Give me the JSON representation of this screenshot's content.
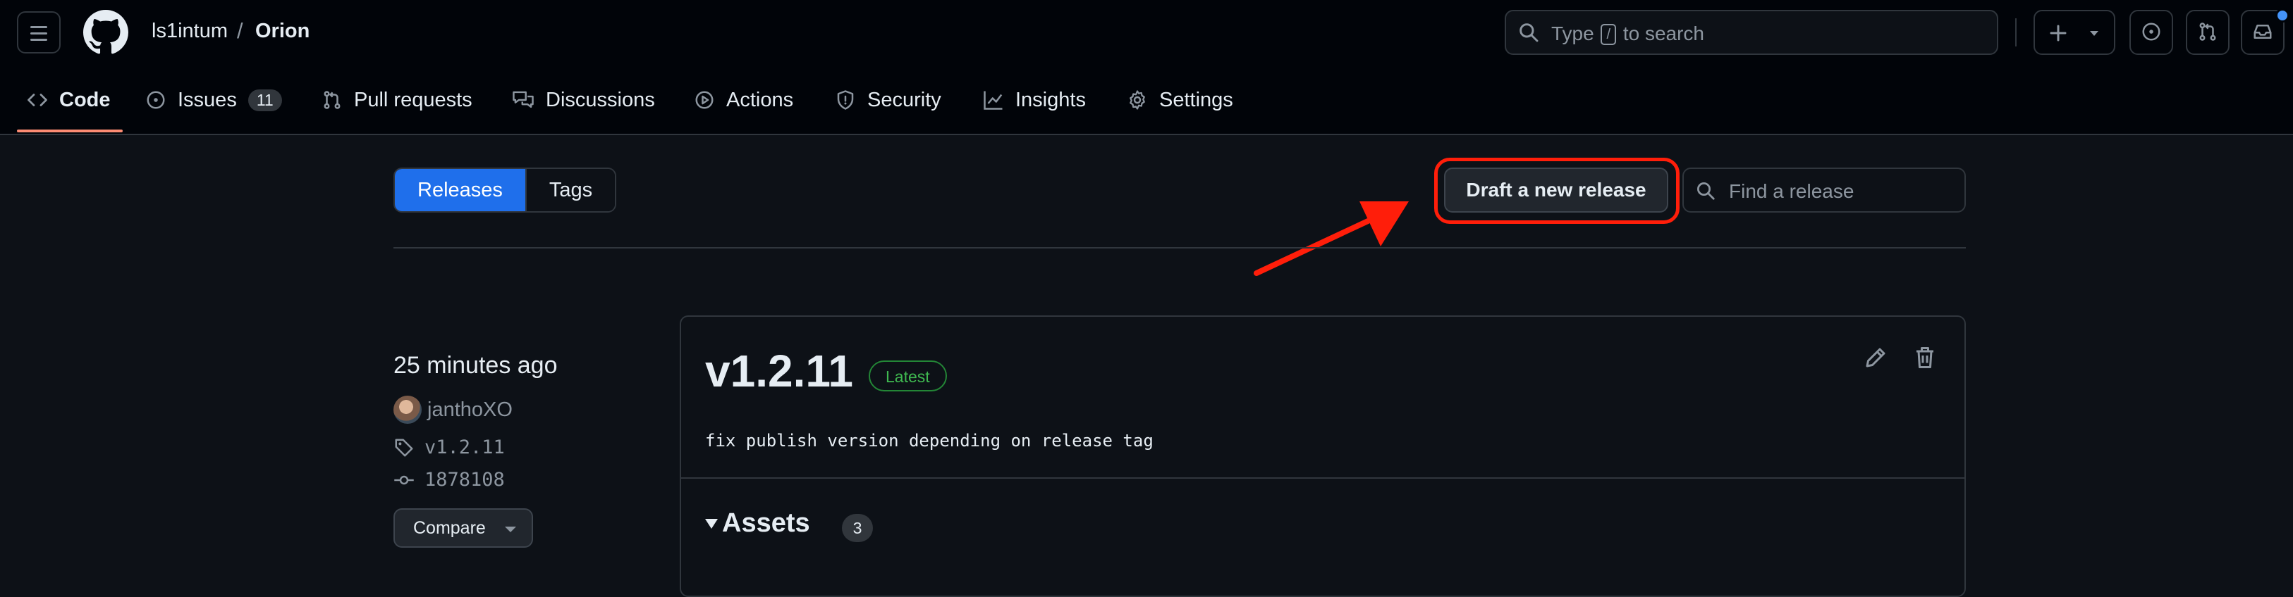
{
  "header": {
    "owner": "ls1intum",
    "separator": "/",
    "repo": "Orion",
    "search": {
      "prefix": "Type",
      "key": "/",
      "suffix": "to search"
    }
  },
  "nav": {
    "tabs": [
      {
        "label": "Code",
        "icon": "code-icon",
        "active": true
      },
      {
        "label": "Issues",
        "icon": "issue-opened-icon",
        "count": "11"
      },
      {
        "label": "Pull requests",
        "icon": "git-pull-request-icon"
      },
      {
        "label": "Discussions",
        "icon": "comment-discussion-icon"
      },
      {
        "label": "Actions",
        "icon": "play-icon"
      },
      {
        "label": "Security",
        "icon": "shield-icon"
      },
      {
        "label": "Insights",
        "icon": "graph-icon"
      },
      {
        "label": "Settings",
        "icon": "gear-icon"
      }
    ]
  },
  "toolbar": {
    "releases_label": "Releases",
    "tags_label": "Tags",
    "draft_label": "Draft a new release",
    "find_placeholder": "Find a release"
  },
  "release": {
    "time": "25 minutes ago",
    "author": "janthoXO",
    "tag": "v1.2.11",
    "commit": "1878108",
    "compare_label": "Compare",
    "version": "v1.2.11",
    "badge": "Latest",
    "message": "fix publish version depending on release tag",
    "assets_label": "Assets",
    "assets_count": "3"
  },
  "colors": {
    "accent_blue": "#1f6feb",
    "annotation_red": "#ff1e0a",
    "latest_green": "#3fb950",
    "active_tab_underline": "#fd8c73"
  }
}
